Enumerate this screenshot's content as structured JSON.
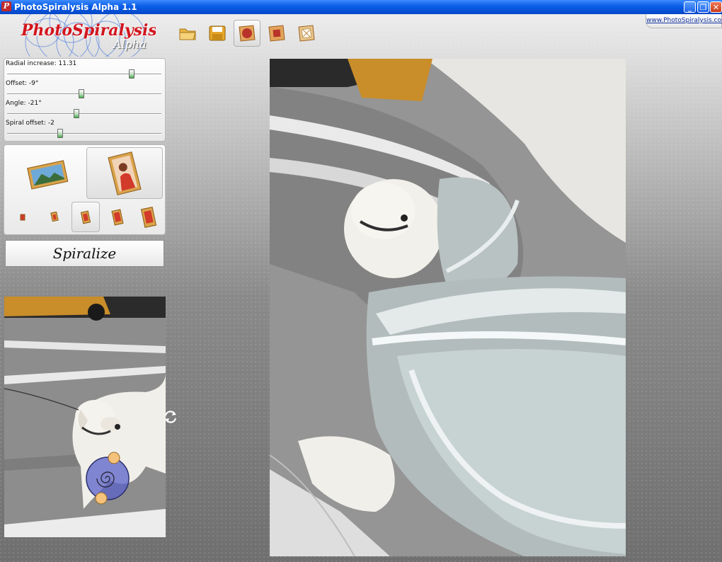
{
  "window": {
    "title": "PhotoSpiralysis Alpha 1.1",
    "app_icon": "P",
    "minimize": "_",
    "restore": "❐",
    "close": "✕"
  },
  "logo": {
    "title": "PhotoSpiralysis",
    "subtitle": "Alpha"
  },
  "url": "www.PhotoSpiralysis.com",
  "toolbar": {
    "buttons": [
      {
        "icon": "open-folder-icon",
        "active": false
      },
      {
        "icon": "save-disk-icon",
        "active": false
      },
      {
        "icon": "circle-frame-icon",
        "active": true
      },
      {
        "icon": "square-frame-icon",
        "active": false
      },
      {
        "icon": "crossed-frame-icon",
        "active": false
      }
    ]
  },
  "sliders": [
    {
      "label": "Radial increase: 11.31",
      "position": 0.8
    },
    {
      "label": "Offset: -9°",
      "position": 0.49
    },
    {
      "label": "Angle: -21°",
      "position": 0.46
    },
    {
      "label": "Spiral offset: -2",
      "position": 0.35
    }
  ],
  "orientation": {
    "selected": "portrait"
  },
  "sizes": {
    "count": 5,
    "selected_index": 2
  },
  "spiralize_label": "Spiralize",
  "colors": {
    "accent_red": "#d3141d",
    "title_blue": "#0a5ee6",
    "spiral_handle": "#f4c27a",
    "spiral_disc": "#5a62c8"
  }
}
